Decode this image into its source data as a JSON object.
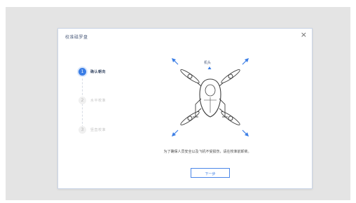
{
  "dialog": {
    "title": "校准磁罗盘",
    "close_glyph": "×"
  },
  "steps": [
    {
      "number": "1",
      "label": "确认朝向",
      "state": "active"
    },
    {
      "number": "2",
      "label": "水平校准",
      "state": "inactive"
    },
    {
      "number": "3",
      "label": "竖直校准",
      "state": "inactive"
    }
  ],
  "illustration": {
    "head_label": "机头",
    "arrow_color": "#3b7ee6",
    "icon": "drone-top-view-icon"
  },
  "instruction_text": "为了确保人员安全以及飞机不受损伤，请在校准前卸桨。",
  "next_button": {
    "label": "下一步"
  },
  "colors": {
    "accent": "#3b7ee6",
    "backdrop": "#e4e4e4",
    "inactive": "#c3c3c3"
  }
}
